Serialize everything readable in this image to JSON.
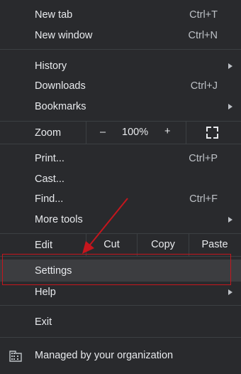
{
  "menu": {
    "new_tab": {
      "label": "New tab",
      "shortcut": "Ctrl+T"
    },
    "new_window": {
      "label": "New window",
      "shortcut": "Ctrl+N"
    },
    "history": {
      "label": "History"
    },
    "downloads": {
      "label": "Downloads",
      "shortcut": "Ctrl+J"
    },
    "bookmarks": {
      "label": "Bookmarks"
    },
    "zoom": {
      "label": "Zoom",
      "minus": "–",
      "value": "100%",
      "plus": "+"
    },
    "print": {
      "label": "Print...",
      "shortcut": "Ctrl+P"
    },
    "cast": {
      "label": "Cast..."
    },
    "find": {
      "label": "Find...",
      "shortcut": "Ctrl+F"
    },
    "more_tools": {
      "label": "More tools"
    },
    "edit": {
      "label": "Edit",
      "cut": "Cut",
      "copy": "Copy",
      "paste": "Paste"
    },
    "settings": {
      "label": "Settings"
    },
    "help": {
      "label": "Help"
    },
    "exit": {
      "label": "Exit"
    },
    "managed": {
      "label": "Managed by your organization"
    }
  },
  "colors": {
    "background": "#292a2d",
    "text": "#e8eaed",
    "shortcut_text": "#bdc1c6",
    "hover_row": "#3c3d40",
    "annotation_red": "#c5161d"
  }
}
